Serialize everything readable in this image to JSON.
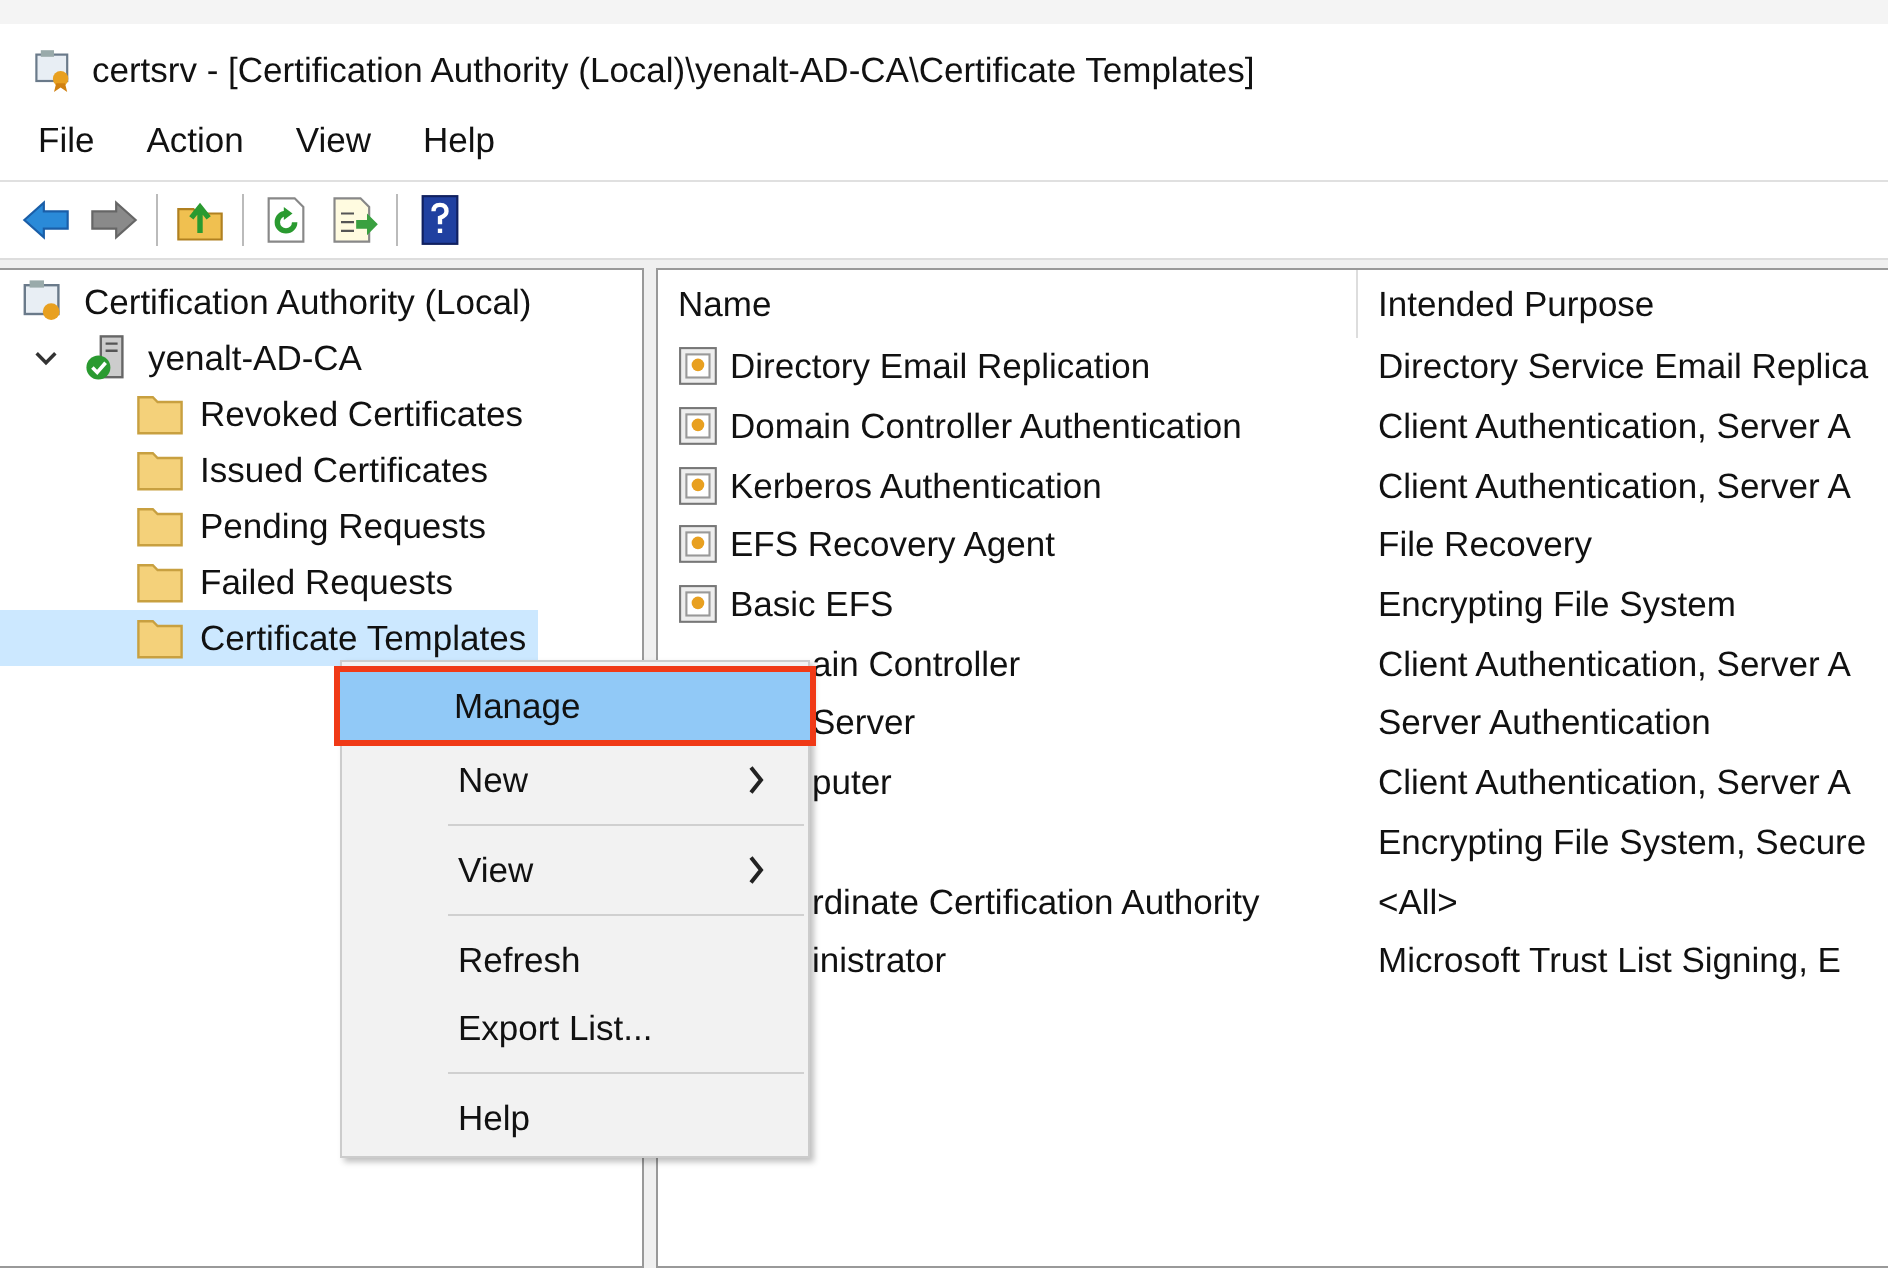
{
  "window": {
    "title": "certsrv - [Certification Authority (Local)\\yenalt-AD-CA\\Certificate Templates]"
  },
  "menu_bar": [
    "File",
    "Action",
    "View",
    "Help"
  ],
  "toolbar": [
    {
      "kind": "back",
      "disabled": false
    },
    {
      "kind": "forward",
      "disabled": true
    },
    {
      "kind": "separator"
    },
    {
      "kind": "up"
    },
    {
      "kind": "separator"
    },
    {
      "kind": "refresh"
    },
    {
      "kind": "export"
    },
    {
      "kind": "separator"
    },
    {
      "kind": "help"
    }
  ],
  "tree": [
    {
      "label": "Certification Authority (Local)",
      "kind": "root",
      "selected": false,
      "children": [
        {
          "label": "yenalt-AD-CA",
          "kind": "server",
          "expanded": true,
          "selected": false,
          "children": [
            {
              "label": "Revoked Certificates",
              "kind": "folder",
              "selected": false
            },
            {
              "label": "Issued Certificates",
              "kind": "folder",
              "selected": false
            },
            {
              "label": "Pending Requests",
              "kind": "folder",
              "selected": false
            },
            {
              "label": "Failed Requests",
              "kind": "folder",
              "selected": false
            },
            {
              "label": "Certificate Templates",
              "kind": "folder",
              "selected": true
            }
          ]
        }
      ]
    }
  ],
  "table": {
    "columns": [
      "Name",
      "Intended Purpose"
    ],
    "rows": [
      {
        "name": "Directory Email Replication",
        "purpose": "Directory Service Email Replica",
        "covered": false
      },
      {
        "name": "Domain Controller Authentication",
        "purpose": "Client Authentication, Server A",
        "covered": false
      },
      {
        "name": "Kerberos Authentication",
        "purpose": "Client Authentication, Server A",
        "covered": false
      },
      {
        "name": "EFS Recovery Agent",
        "purpose": "File Recovery",
        "covered": false
      },
      {
        "name": "Basic EFS",
        "purpose": "Encrypting File System",
        "covered": false
      },
      {
        "name": "ain Controller",
        "purpose": "Client Authentication, Server A",
        "covered": true
      },
      {
        "name": "Server",
        "purpose": "Server Authentication",
        "covered": true
      },
      {
        "name": "puter",
        "purpose": "Client Authentication, Server A",
        "covered": true
      },
      {
        "purpose": "Encrypting File System, Secure"
      },
      {
        "name": "rdinate Certification Authority",
        "purpose": "<All>",
        "covered": true
      },
      {
        "name": "inistrator",
        "purpose": "Microsoft Trust List Signing, E",
        "covered": true
      }
    ]
  },
  "context_menu": [
    {
      "kind": "item",
      "label": "Manage",
      "submenu": false,
      "selected": true,
      "outlined": true
    },
    {
      "kind": "item",
      "label": "New",
      "submenu": true,
      "selected": false,
      "outlined": false
    },
    {
      "kind": "separator"
    },
    {
      "kind": "item",
      "label": "View",
      "submenu": true,
      "selected": false,
      "outlined": false
    },
    {
      "kind": "separator"
    },
    {
      "kind": "item",
      "label": "Refresh",
      "submenu": false,
      "selected": false,
      "outlined": false
    },
    {
      "kind": "item",
      "label": "Export List...",
      "submenu": false,
      "selected": false,
      "outlined": false
    },
    {
      "kind": "separator"
    },
    {
      "kind": "item",
      "label": "Help",
      "submenu": false,
      "selected": false,
      "outlined": false
    }
  ]
}
